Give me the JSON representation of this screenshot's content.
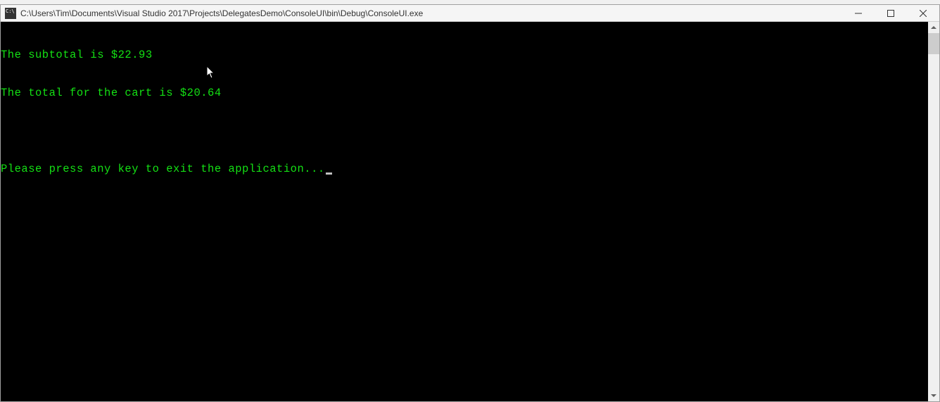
{
  "window": {
    "title": "C:\\Users\\Tim\\Documents\\Visual Studio 2017\\Projects\\DelegatesDemo\\ConsoleUI\\bin\\Debug\\ConsoleUI.exe"
  },
  "console": {
    "lines": {
      "line1": "The subtotal is $22.93",
      "line2": "The total for the cart is $20.64",
      "line3": "Please press any key to exit the application..."
    }
  }
}
